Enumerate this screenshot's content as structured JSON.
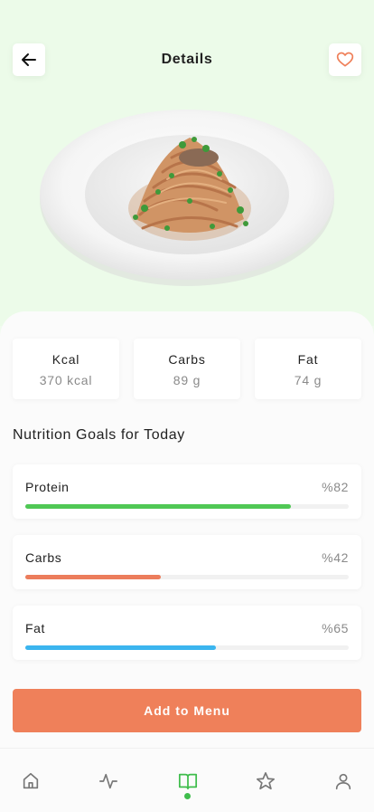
{
  "header": {
    "title": "Details"
  },
  "icons": {
    "back": "arrow-left-icon",
    "favorite": "heart-icon"
  },
  "stats": [
    {
      "label": "Kcal",
      "value": "370 kcal"
    },
    {
      "label": "Carbs",
      "value": "89 g"
    },
    {
      "label": "Fat",
      "value": "74 g"
    }
  ],
  "goals": {
    "title": "Nutrition Goals for Today",
    "items": [
      {
        "name": "Protein",
        "percent_label": "%82",
        "progress": 0.82,
        "color": "#50c855"
      },
      {
        "name": "Carbs",
        "percent_label": "%42",
        "progress": 0.42,
        "color": "#ec7d5c"
      },
      {
        "name": "Fat",
        "percent_label": "%65",
        "progress": 0.59,
        "color": "#3bb5ef"
      }
    ]
  },
  "cta": {
    "label": "Add to Menu"
  },
  "colors": {
    "accent_green": "#3fbd4c",
    "cta_orange": "#ef805a",
    "heart": "#ef805a"
  },
  "nav": {
    "items": [
      "home-icon",
      "activity-icon",
      "book-icon",
      "star-icon",
      "user-icon"
    ],
    "active": "book-icon"
  }
}
